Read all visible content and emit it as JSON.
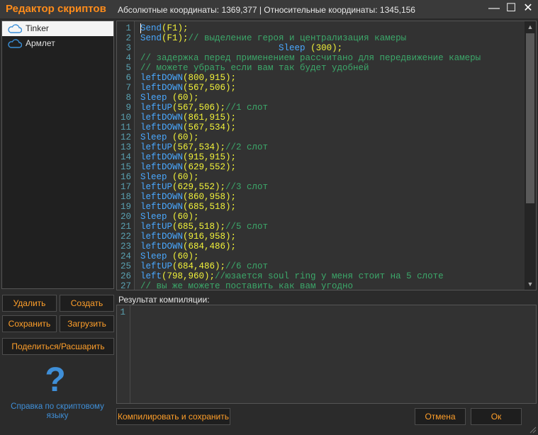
{
  "window": {
    "title": "Редактор скриптов",
    "coords_text": "Абсолютные координаты: 1369,377 | Относительные координаты: 1345,156",
    "minimize_glyph": "—",
    "maximize_glyph": "☐",
    "close_glyph": "✕"
  },
  "tree": {
    "items": [
      {
        "label": "Tinker",
        "icon": "cloud-icon",
        "selected": true
      },
      {
        "label": "Армлет",
        "icon": "cloud-icon",
        "selected": false
      }
    ]
  },
  "editor": {
    "line_numbers": [
      "1",
      "2",
      "3",
      "4",
      "5",
      "6",
      "7",
      "8",
      "9",
      "10",
      "11",
      "12",
      "13",
      "14",
      "15",
      "16",
      "17",
      "18",
      "19",
      "20",
      "21",
      "22",
      "23",
      "24",
      "25",
      "26",
      "27"
    ],
    "lines": [
      [
        {
          "t": "Send",
          "c": "kw"
        },
        {
          "t": "(F1);",
          "c": "yl"
        }
      ],
      [
        {
          "t": "Send",
          "c": "kw"
        },
        {
          "t": "(F1);",
          "c": "yl"
        },
        {
          "t": "// выделение героя и централизация камеры",
          "c": "cm"
        }
      ],
      [
        {
          "t": "                          ",
          "c": "yl"
        },
        {
          "t": "Sleep",
          "c": "kw"
        },
        {
          "t": " (300);",
          "c": "yl"
        }
      ],
      [
        {
          "t": "// задержка перед применением рассчитано для передвижение камеры",
          "c": "cm"
        }
      ],
      [
        {
          "t": "// можете убрать если вам так будет удобней",
          "c": "cm"
        }
      ],
      [
        {
          "t": "leftDOWN",
          "c": "kw"
        },
        {
          "t": "(800,915);",
          "c": "yl"
        }
      ],
      [
        {
          "t": "leftDOWN",
          "c": "kw"
        },
        {
          "t": "(567,506);",
          "c": "yl"
        }
      ],
      [
        {
          "t": "Sleep",
          "c": "kw"
        },
        {
          "t": " (60);",
          "c": "yl"
        }
      ],
      [
        {
          "t": "leftUP",
          "c": "kw"
        },
        {
          "t": "(567,506);",
          "c": "yl"
        },
        {
          "t": "//1 слот",
          "c": "cm"
        }
      ],
      [
        {
          "t": "leftDOWN",
          "c": "kw"
        },
        {
          "t": "(861,915);",
          "c": "yl"
        }
      ],
      [
        {
          "t": "leftDOWN",
          "c": "kw"
        },
        {
          "t": "(567,534);",
          "c": "yl"
        }
      ],
      [
        {
          "t": "Sleep",
          "c": "kw"
        },
        {
          "t": " (60);",
          "c": "yl"
        }
      ],
      [
        {
          "t": "leftUP",
          "c": "kw"
        },
        {
          "t": "(567,534);",
          "c": "yl"
        },
        {
          "t": "//2 слот",
          "c": "cm"
        }
      ],
      [
        {
          "t": "leftDOWN",
          "c": "kw"
        },
        {
          "t": "(915,915);",
          "c": "yl"
        }
      ],
      [
        {
          "t": "leftDOWN",
          "c": "kw"
        },
        {
          "t": "(629,552);",
          "c": "yl"
        }
      ],
      [
        {
          "t": "Sleep",
          "c": "kw"
        },
        {
          "t": " (60);",
          "c": "yl"
        }
      ],
      [
        {
          "t": "leftUP",
          "c": "kw"
        },
        {
          "t": "(629,552);",
          "c": "yl"
        },
        {
          "t": "//3 слот",
          "c": "cm"
        }
      ],
      [
        {
          "t": "leftDOWN",
          "c": "kw"
        },
        {
          "t": "(860,958);",
          "c": "yl"
        }
      ],
      [
        {
          "t": "leftDOWN",
          "c": "kw"
        },
        {
          "t": "(685,518);",
          "c": "yl"
        }
      ],
      [
        {
          "t": "Sleep",
          "c": "kw"
        },
        {
          "t": " (60);",
          "c": "yl"
        }
      ],
      [
        {
          "t": "leftUP",
          "c": "kw"
        },
        {
          "t": "(685,518);",
          "c": "yl"
        },
        {
          "t": "//5 слот",
          "c": "cm"
        }
      ],
      [
        {
          "t": "leftDOWN",
          "c": "kw"
        },
        {
          "t": "(916,958);",
          "c": "yl"
        }
      ],
      [
        {
          "t": "leftDOWN",
          "c": "kw"
        },
        {
          "t": "(684,486);",
          "c": "yl"
        }
      ],
      [
        {
          "t": "Sleep",
          "c": "kw"
        },
        {
          "t": " (60);",
          "c": "yl"
        }
      ],
      [
        {
          "t": "leftUP",
          "c": "kw"
        },
        {
          "t": "(684,486);",
          "c": "yl"
        },
        {
          "t": "//6 слот",
          "c": "cm"
        }
      ],
      [
        {
          "t": "left",
          "c": "kw"
        },
        {
          "t": "(798,960);",
          "c": "yl"
        },
        {
          "t": "//юзается soul ring у меня стоит на 5 слоте",
          "c": "cm"
        }
      ],
      [
        {
          "t": "// вы же можете поставить как вам угодно",
          "c": "cm"
        }
      ]
    ]
  },
  "buttons": {
    "delete": "Удалить",
    "create": "Создать",
    "save": "Сохранить",
    "load": "Загрузить",
    "share": "Поделиться/Расшарить",
    "compile_save": "Компилировать и сохранить",
    "cancel": "Отмена",
    "ok": "Ок"
  },
  "help": {
    "text": "Справка по скриптовому языку",
    "icon": "question-mark-icon"
  },
  "result": {
    "label": "Результат компиляции:",
    "line_number": "1"
  },
  "colors": {
    "accent": "#ff9f2a",
    "keyword": "#4aa8ff",
    "argument": "#f2f23a",
    "comment": "#3ca86a",
    "link": "#3f8fd8"
  }
}
